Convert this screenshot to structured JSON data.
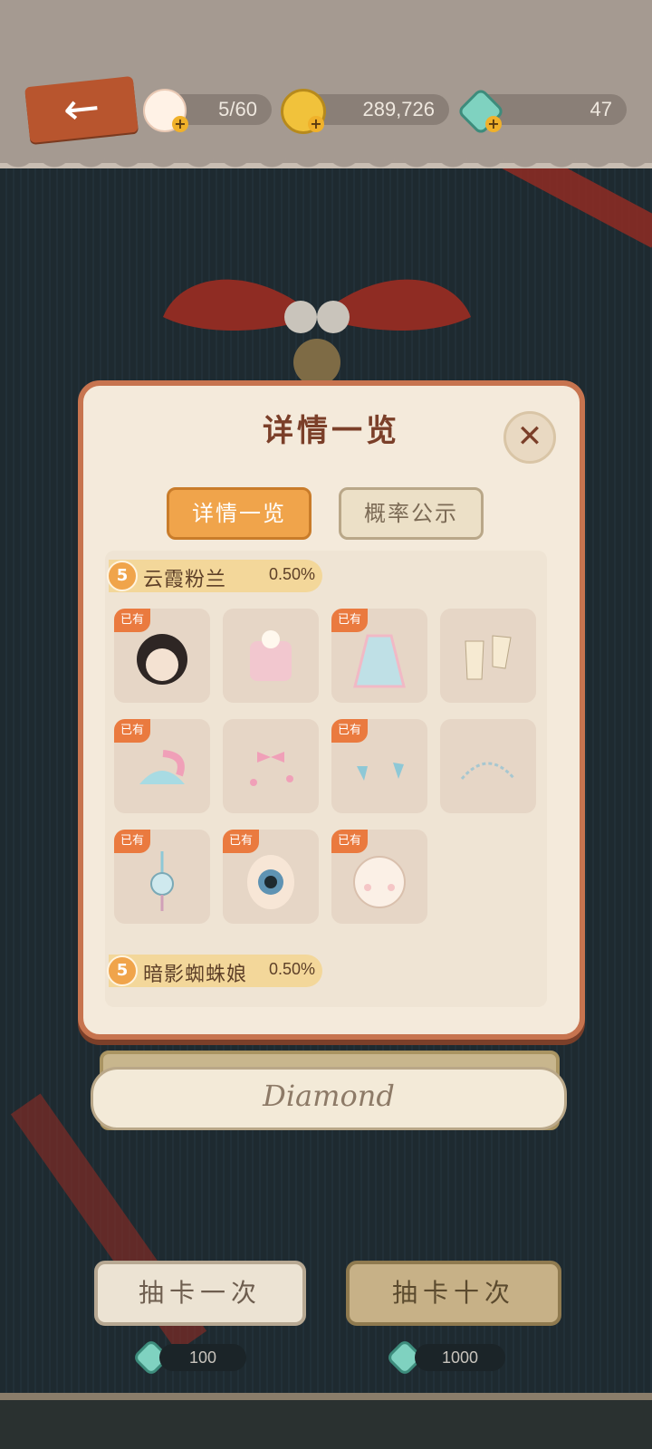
{
  "topbar": {
    "back_label": "←",
    "resources": [
      {
        "name": "stamina",
        "value": "5/60",
        "icon": "cake-icon"
      },
      {
        "name": "coins",
        "value": "289,726",
        "icon": "coin-icon"
      },
      {
        "name": "gems",
        "value": "47",
        "icon": "gem-icon"
      }
    ]
  },
  "dialog": {
    "title": "详情一览",
    "close_label": "✕",
    "tabs": [
      {
        "label": "详情一览",
        "active": true
      },
      {
        "label": "概率公示",
        "active": false
      }
    ],
    "sets": [
      {
        "rarity": "5",
        "name": "云霞粉兰",
        "rate": "0.50%"
      },
      {
        "rarity": "5",
        "name": "暗影蜘蛛娘",
        "rate": "0.50%"
      }
    ],
    "owned_label": "已有",
    "items": [
      {
        "icon": "hair-icon",
        "owned": true
      },
      {
        "icon": "jacket-icon",
        "owned": false
      },
      {
        "icon": "skirt-icon",
        "owned": true
      },
      {
        "icon": "socks-icon",
        "owned": false
      },
      {
        "icon": "hat-icon",
        "owned": true
      },
      {
        "icon": "ribbon-icon",
        "owned": false
      },
      {
        "icon": "earrings-icon",
        "owned": true
      },
      {
        "icon": "necklace-icon",
        "owned": false
      },
      {
        "icon": "pendant-icon",
        "owned": true
      },
      {
        "icon": "eye-icon",
        "owned": true
      },
      {
        "icon": "face-icon",
        "owned": true
      }
    ]
  },
  "banner_text": "Diamond",
  "draw": {
    "single_label": "抽卡一次",
    "single_cost": "100",
    "ten_label": "抽卡十次",
    "ten_cost": "1000"
  },
  "colors": {
    "accent": "#f0a44b",
    "panel_border": "#c7744f",
    "title": "#7b3f29"
  }
}
